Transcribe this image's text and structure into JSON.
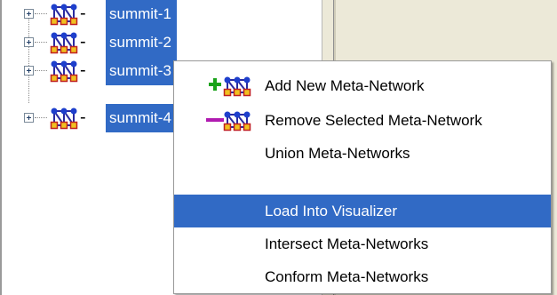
{
  "tree": {
    "nodes": [
      {
        "label": "summit-1",
        "icon": "meta-network-icon"
      },
      {
        "label": "summit-2",
        "icon": "meta-network-icon"
      },
      {
        "label": "summit-3",
        "icon": "meta-network-icon"
      },
      {
        "label": "summit-4",
        "icon": "meta-network-icon"
      }
    ]
  },
  "context_menu": {
    "items": [
      {
        "label": "Add New Meta-Network",
        "icon": "add-meta-network-icon"
      },
      {
        "label": "Remove Selected Meta-Network",
        "icon": "remove-meta-network-icon"
      },
      {
        "label": "Union Meta-Networks"
      },
      {
        "label": "Load Into Visualizer",
        "highlighted": true
      },
      {
        "label": "Intersect Meta-Networks"
      },
      {
        "label": "Conform Meta-Networks"
      }
    ]
  },
  "colors": {
    "selection": "#316ac5",
    "panel": "#ece9d8"
  }
}
